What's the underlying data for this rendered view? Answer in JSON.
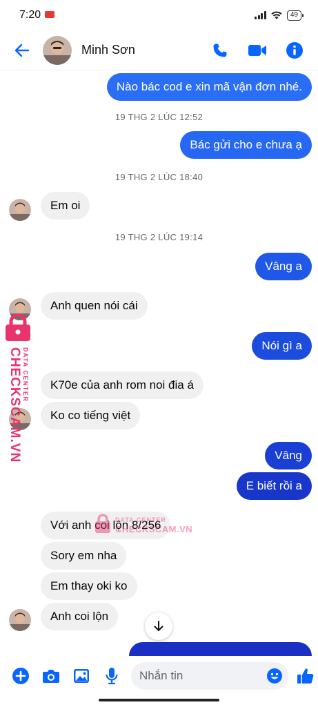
{
  "status_bar": {
    "time": "7:20",
    "battery": "49"
  },
  "header": {
    "contact_name": "Minh Sơn"
  },
  "messages": [
    {
      "side": "out",
      "text": "Nào bác cod e xin mã vận đơn nhé."
    },
    {
      "type": "timestamp",
      "text": "19 THG 2 LÚC 12:52"
    },
    {
      "side": "out",
      "text": "Bác gửi cho e chưa ạ"
    },
    {
      "type": "timestamp",
      "text": "19 THG 2 LÚC 18:40"
    },
    {
      "side": "in",
      "text": "Em oi"
    },
    {
      "type": "timestamp",
      "text": "19 THG 2 LÚC 19:14"
    },
    {
      "side": "out",
      "text": "Vâng a"
    },
    {
      "side": "in",
      "text": "Anh quen nói cái"
    },
    {
      "side": "out",
      "text": "Nói gì a"
    },
    {
      "side": "in",
      "text": "K70e của anh rom noi đia á"
    },
    {
      "side": "in",
      "text": "Ko co tiếng việt"
    },
    {
      "side": "out",
      "text": "Vâng"
    },
    {
      "side": "out",
      "text": "E biết rồi a"
    },
    {
      "side": "in",
      "text": "Với anh coi lộn 8/256"
    },
    {
      "side": "in",
      "text": "Sory em nha"
    },
    {
      "side": "in",
      "text": "Em thay oki ko"
    },
    {
      "side": "in",
      "text": "Anh coi lộn"
    }
  ],
  "watermark": {
    "brand": "CHECKSCAM.VN",
    "tagline": "DATA CENTER"
  },
  "composer": {
    "placeholder": "Nhắn tin"
  },
  "colors": {
    "accent": "#0866ff",
    "bubble_out_top": "#2a74f6",
    "bubble_out_bottom": "#1a2fbf",
    "bubble_in": "#f0f0f0",
    "watermark": "#e8336d"
  },
  "icons": [
    "back-arrow-icon",
    "phone-icon",
    "video-icon",
    "info-icon",
    "plus-icon",
    "camera-icon",
    "image-icon",
    "mic-icon",
    "emoji-icon",
    "like-icon",
    "arrow-down-icon",
    "lock-icon"
  ]
}
